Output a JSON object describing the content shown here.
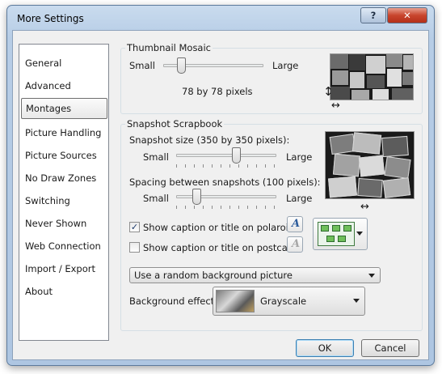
{
  "window": {
    "title": "More Settings",
    "help_label": "?",
    "close_label": "✕"
  },
  "sidebar": {
    "items": [
      {
        "label": "General"
      },
      {
        "label": "Advanced"
      },
      {
        "label": "Montages",
        "selected": true
      },
      {
        "label": "Picture Handling"
      },
      {
        "label": "Picture Sources"
      },
      {
        "label": "No Draw Zones"
      },
      {
        "label": "Switching"
      },
      {
        "label": "Never Shown"
      },
      {
        "label": "Web Connection"
      },
      {
        "label": "Import / Export"
      },
      {
        "label": "About"
      }
    ]
  },
  "thumbnail_mosaic": {
    "group_label": "Thumbnail Mosaic",
    "slider_min_label": "Small",
    "slider_max_label": "Large",
    "slider_value": 0.18,
    "size_text": "78 by 78 pixels",
    "preview_icon": "mosaic-preview"
  },
  "snapshot_scrapbook": {
    "group_label": "Snapshot Scrapbook",
    "snapshot_size_label": "Snapshot size (350 by 350 pixels):",
    "snapshot_min_label": "Small",
    "snapshot_max_label": "Large",
    "snapshot_value": 0.6,
    "spacing_label": "Spacing between snapshots (100 pixels):",
    "spacing_min_label": "Small",
    "spacing_max_label": "Large",
    "spacing_value": 0.2,
    "caption_polaroids_label": "Show caption or title on polaroids",
    "caption_polaroids_checked": true,
    "caption_postcards_label": "Show caption or title on postcards",
    "caption_postcards_checked": false,
    "font_icon_label": "A",
    "layout_icon": "grid-layout-icon",
    "background_select_value": "Use a random background picture",
    "background_effect_label": "Background effect:",
    "background_effect_value": "Grayscale"
  },
  "buttons": {
    "ok_label": "OK",
    "cancel_label": "Cancel"
  },
  "colors": {
    "window_frame": "#b7cde6",
    "close_button": "#c8452d",
    "panel": "#f0f0f0"
  }
}
